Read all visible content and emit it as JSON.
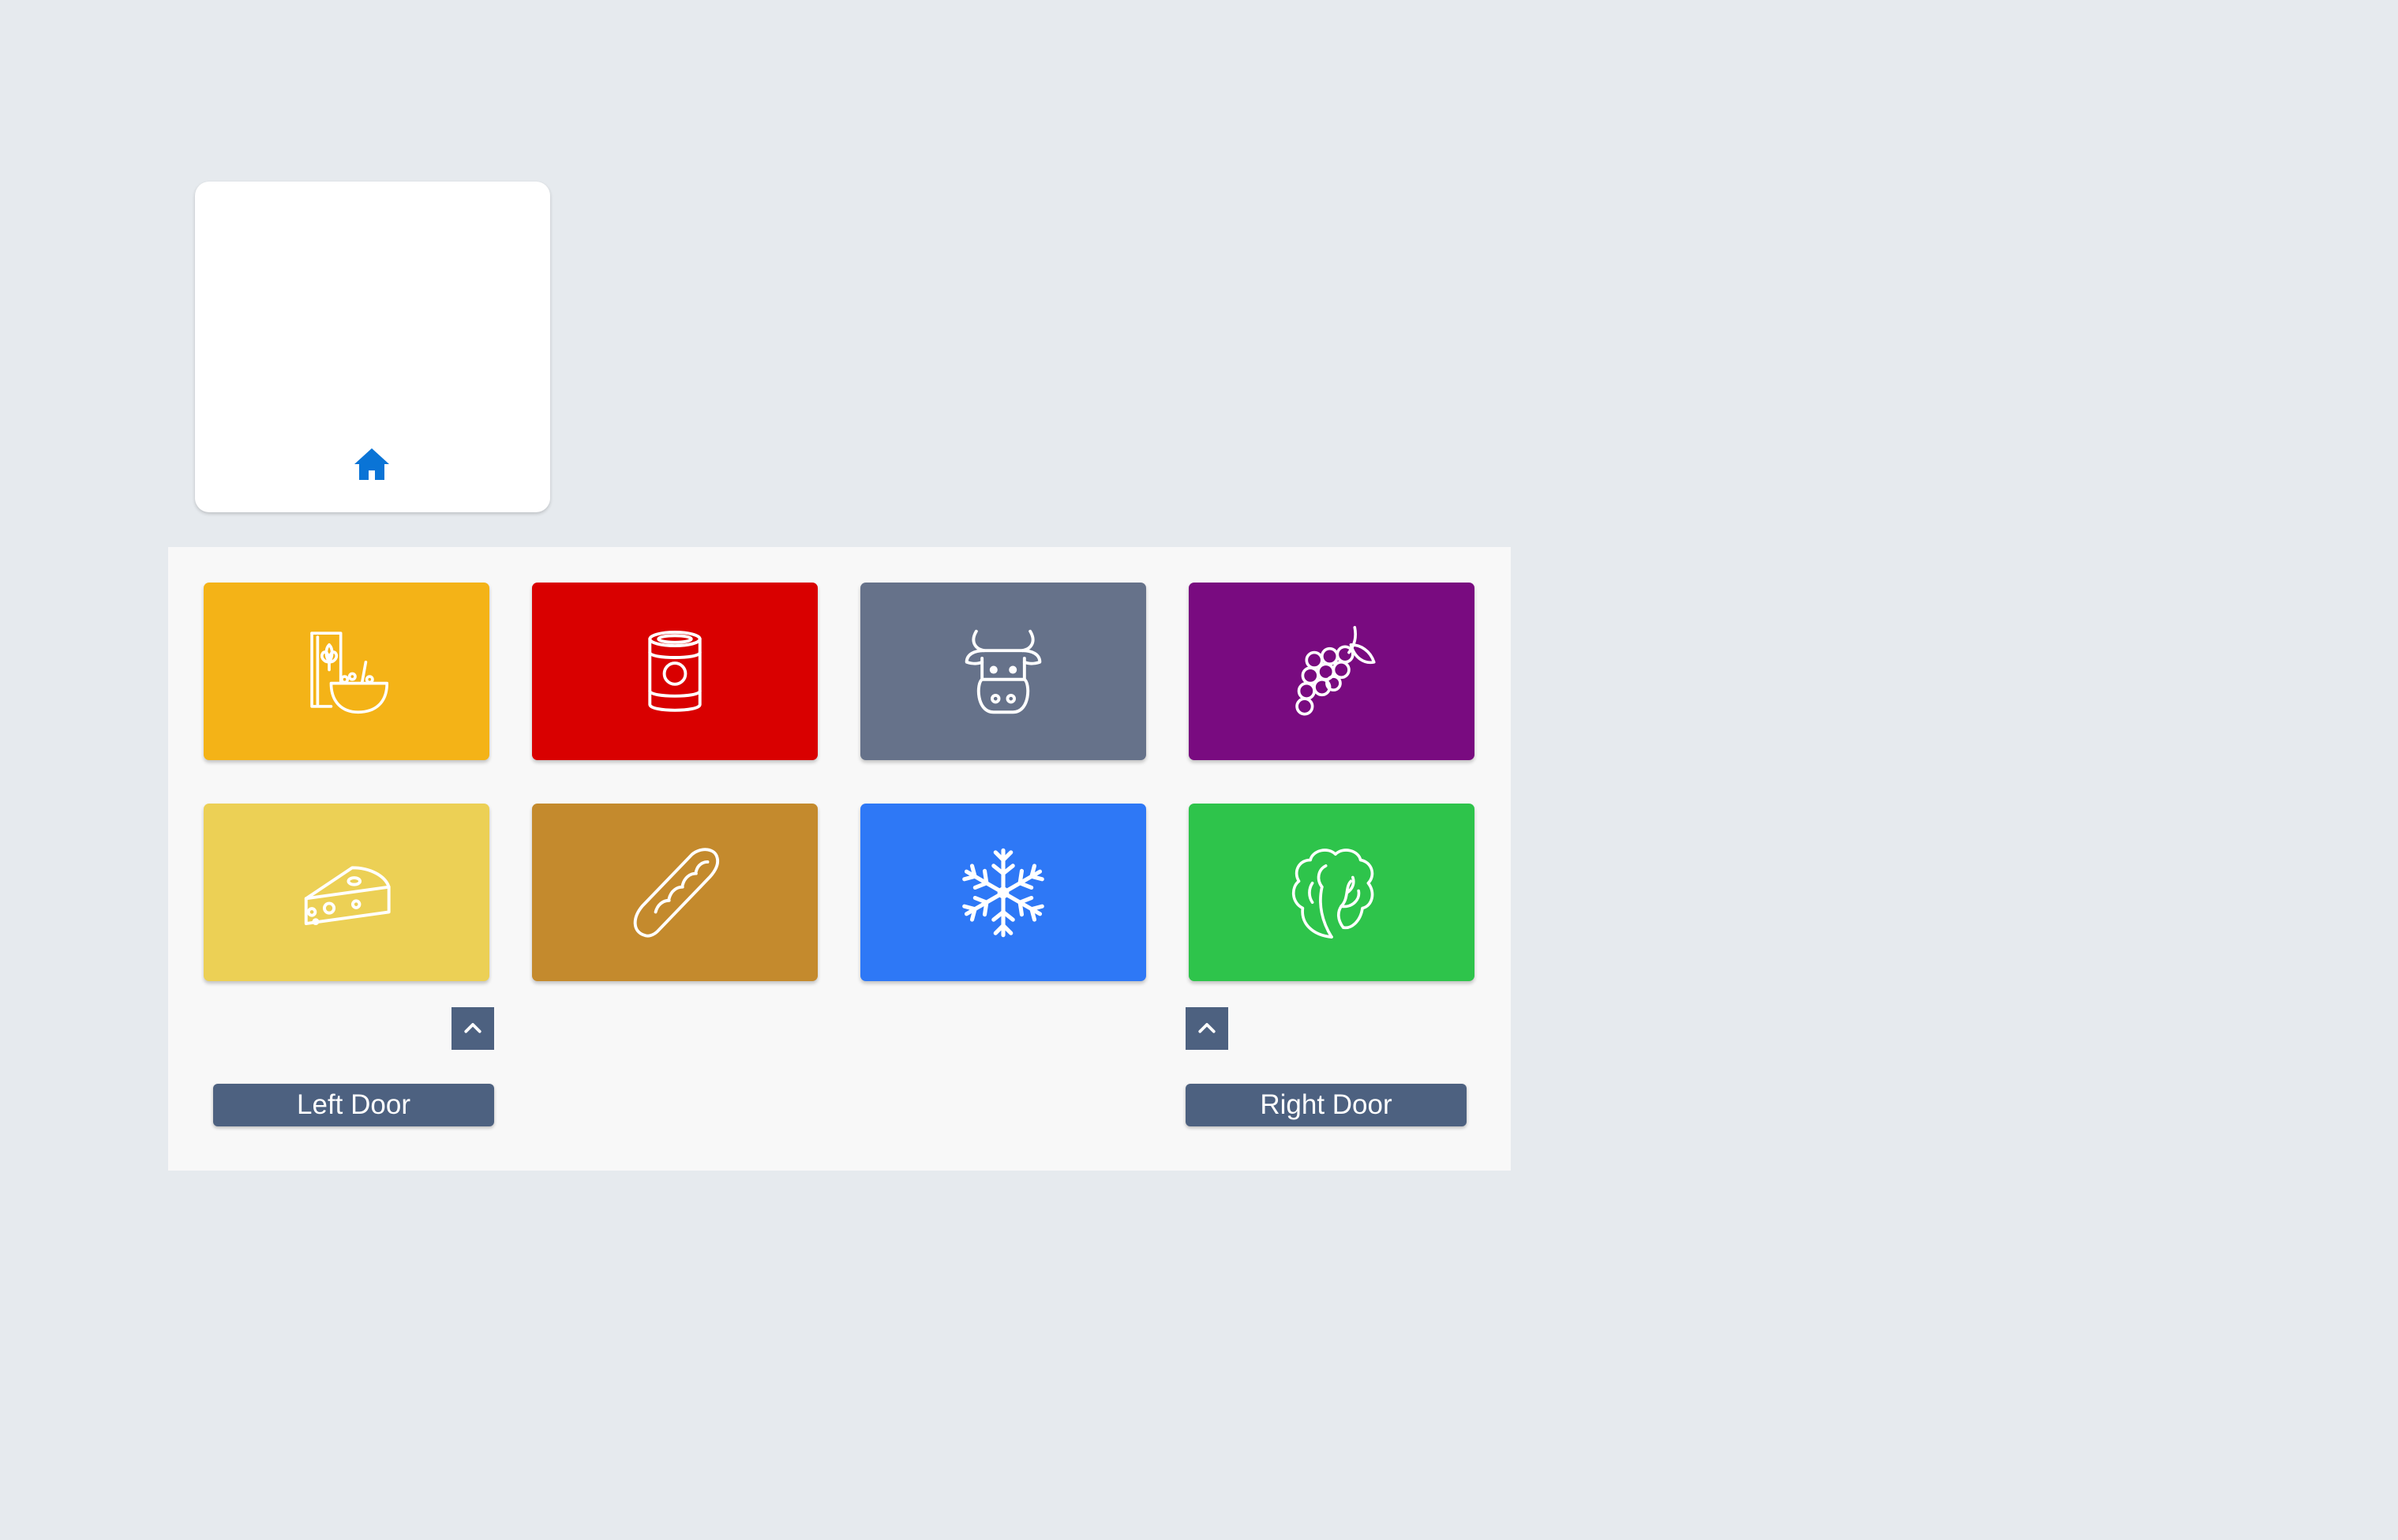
{
  "home": {
    "icon": "home-icon"
  },
  "tiles": [
    {
      "category": "breakfast-cereal",
      "icon": "cereal-icon",
      "color": "#f4b317"
    },
    {
      "category": "canned-goods",
      "icon": "can-icon",
      "color": "#d90000"
    },
    {
      "category": "dairy-milk",
      "icon": "cow-icon",
      "color": "#66728a"
    },
    {
      "category": "fruit",
      "icon": "grapes-icon",
      "color": "#790b80"
    },
    {
      "category": "cheese",
      "icon": "cheese-icon",
      "color": "#ecd055"
    },
    {
      "category": "bread",
      "icon": "bread-icon",
      "color": "#c48a2d"
    },
    {
      "category": "frozen",
      "icon": "snowflake-icon",
      "color": "#2e78f6"
    },
    {
      "category": "vegetables",
      "icon": "lettuce-icon",
      "color": "#2ec44b"
    }
  ],
  "controls": {
    "left_toggle_icon": "chevron-up-icon",
    "right_toggle_icon": "chevron-up-icon",
    "left_door_label": "Left Door",
    "right_door_label": "Right Door"
  },
  "colors": {
    "page_background": "#e6eaee",
    "panel_background": "#f8f8f8",
    "control_background": "#4d6180",
    "home_icon": "#0a74d6"
  }
}
